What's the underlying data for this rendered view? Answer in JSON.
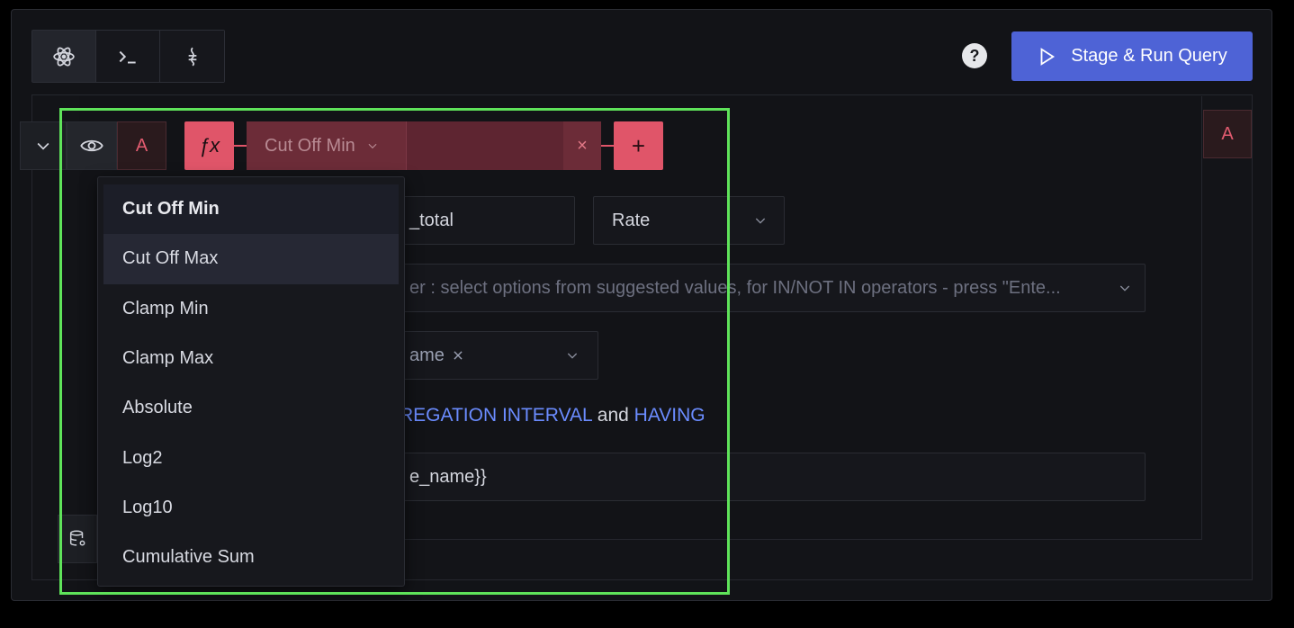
{
  "toolbar": {
    "modes": [
      {
        "icon": "atom-icon",
        "active": true
      },
      {
        "icon": "terminal-icon",
        "active": false
      },
      {
        "icon": "promql-icon",
        "active": false
      }
    ],
    "help_label": "?",
    "run_button_label": "Stage & Run Query"
  },
  "query": {
    "letter": "A",
    "fx_label": "ƒx",
    "function_select": {
      "label": "Cut Off Min",
      "clear": "×"
    },
    "add_function_label": "+",
    "right_letter": "A"
  },
  "form": {
    "metric_value": "_total",
    "aggregation_value": "Rate",
    "filter_placeholder": "er : select options from suggested values, for IN/NOT IN operators - press \"Ente...",
    "groupby_chip": "ame",
    "hint": {
      "link1": "REGATION INTERVAL",
      "middle": " and ",
      "link2": "HAVING"
    },
    "legend_value": "e_name}}"
  },
  "function_menu": {
    "items": [
      "Cut Off Min",
      "Cut Off Max",
      "Clamp Min",
      "Clamp Max",
      "Absolute",
      "Log2",
      "Log10",
      "Cumulative Sum"
    ],
    "selected_index": 0,
    "hover_index": 1
  },
  "colors": {
    "accent": "#4e63d6",
    "function": "#e05569",
    "highlight": "#5fe35a",
    "link": "#6b8cff"
  }
}
